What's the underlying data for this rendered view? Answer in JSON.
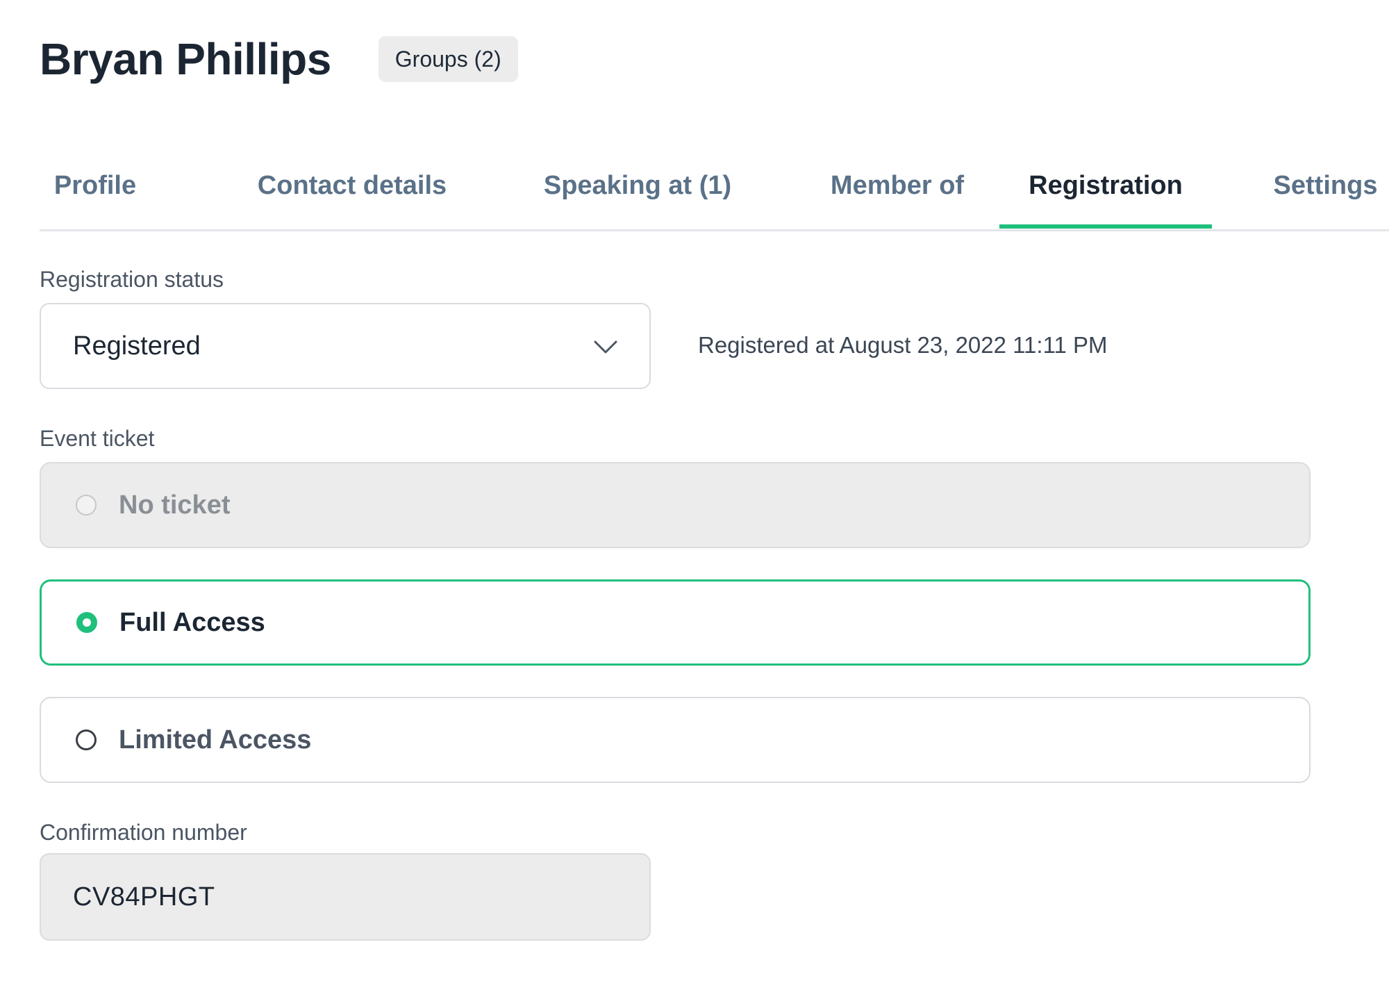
{
  "header": {
    "name": "Bryan Phillips",
    "groups_badge": "Groups (2)"
  },
  "tabs": [
    {
      "label": "Profile",
      "active": false
    },
    {
      "label": "Contact details",
      "active": false
    },
    {
      "label": "Speaking at (1)",
      "active": false
    },
    {
      "label": "Member of",
      "active": false
    },
    {
      "label": "Registration",
      "active": true
    },
    {
      "label": "Settings",
      "active": false
    }
  ],
  "registration": {
    "status_label": "Registration status",
    "status_value": "Registered",
    "registered_at": "Registered at August 23, 2022 11:11 PM"
  },
  "ticket": {
    "label": "Event ticket",
    "options": [
      {
        "label": "No ticket",
        "state": "disabled"
      },
      {
        "label": "Full Access",
        "state": "selected"
      },
      {
        "label": "Limited Access",
        "state": "unselected"
      }
    ]
  },
  "confirmation": {
    "label": "Confirmation number",
    "value": "CV84PHGT"
  },
  "colors": {
    "accent": "#1fbf7c",
    "tab_inactive": "#5a7188",
    "tab_active": "#1c2633",
    "disabled_bg": "#ececec"
  },
  "icons": {
    "select_chevron": "chevron-down-icon"
  }
}
